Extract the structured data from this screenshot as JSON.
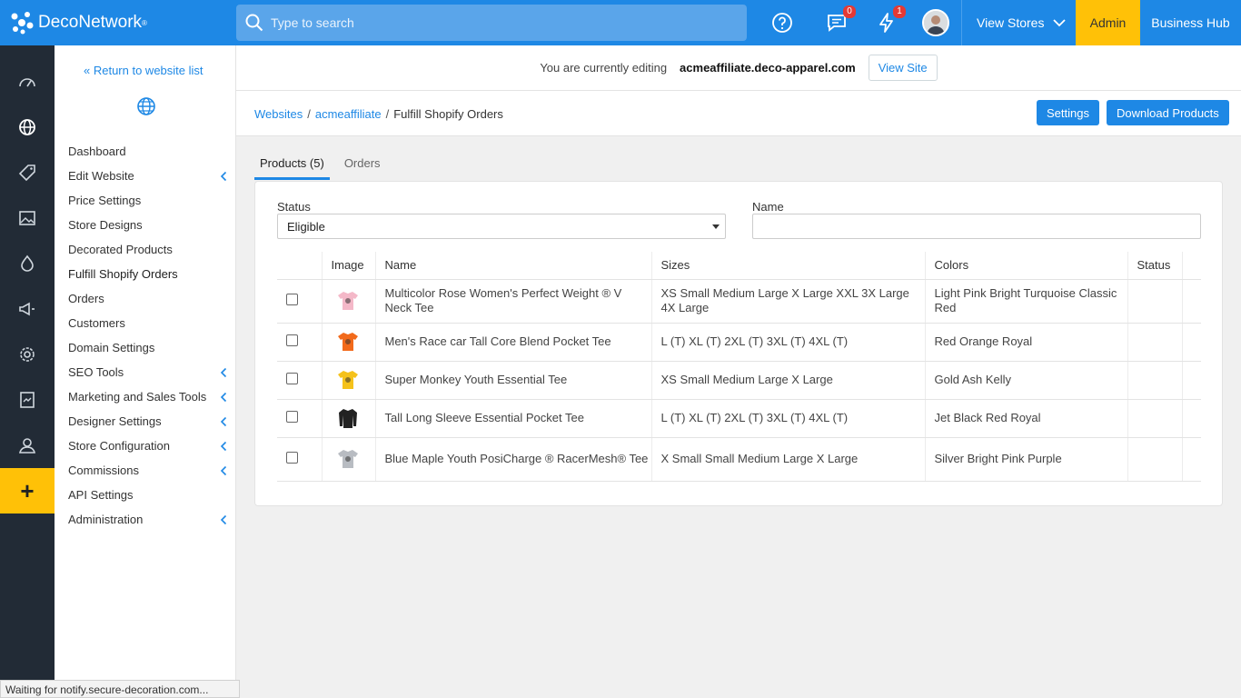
{
  "app": {
    "brand": "DecoNetwork",
    "brand_mark": "®",
    "search_placeholder": "Type to search",
    "messages_count": "0",
    "alerts_count": "1",
    "view_stores": "View Stores",
    "admin": "Admin",
    "business_hub": "Business Hub"
  },
  "sidebar": {
    "return_link": "« Return to website list",
    "items": [
      {
        "label": "Dashboard",
        "chevron": false
      },
      {
        "label": "Edit Website",
        "chevron": true
      },
      {
        "label": "Price Settings",
        "chevron": false
      },
      {
        "label": "Store Designs",
        "chevron": false
      },
      {
        "label": "Decorated Products",
        "chevron": false
      },
      {
        "label": "Fulfill Shopify Orders",
        "chevron": false,
        "active": true
      },
      {
        "label": "Orders",
        "chevron": false
      },
      {
        "label": "Customers",
        "chevron": false
      },
      {
        "label": "Domain Settings",
        "chevron": false
      },
      {
        "label": "SEO Tools",
        "chevron": true
      },
      {
        "label": "Marketing and Sales Tools",
        "chevron": true
      },
      {
        "label": "Designer Settings",
        "chevron": true
      },
      {
        "label": "Store Configuration",
        "chevron": true
      },
      {
        "label": "Commissions",
        "chevron": true
      },
      {
        "label": "API Settings",
        "chevron": false
      },
      {
        "label": "Administration",
        "chevron": true
      }
    ]
  },
  "editing": {
    "label": "You are currently editing",
    "site": "acmeaffiliate.deco-apparel.com",
    "view_site": "View Site"
  },
  "breadcrumb": {
    "root": "Websites",
    "sep": "/",
    "site": "acmeaffiliate",
    "current": "Fulfill Shopify Orders"
  },
  "actions": {
    "settings": "Settings",
    "download": "Download Products"
  },
  "tabs": {
    "products": "Products (5)",
    "orders": "Orders"
  },
  "filters": {
    "status_label": "Status",
    "status_value": "Eligible",
    "name_label": "Name",
    "name_value": ""
  },
  "table": {
    "headers": {
      "image": "Image",
      "name": "Name",
      "sizes": "Sizes",
      "colors": "Colors",
      "status": "Status"
    },
    "rows": [
      {
        "name": "Multicolor Rose Women's Perfect Weight ® V Neck Tee",
        "sizes": "XS Small Medium Large X Large XXL 3X Large 4X Large",
        "colors": "Light Pink Bright Turquoise Classic Red",
        "status": "",
        "thumb_color": "#f4b8c8"
      },
      {
        "name": "Men's Race car Tall Core Blend Pocket Tee",
        "sizes": "L (T) XL (T) 2XL (T) 3XL (T) 4XL (T)",
        "colors": "Red Orange Royal",
        "status": "",
        "thumb_color": "#f26a1b"
      },
      {
        "name": "Super Monkey Youth Essential Tee",
        "sizes": "XS Small Medium Large X Large",
        "colors": "Gold Ash Kelly",
        "status": "",
        "thumb_color": "#f5c21b"
      },
      {
        "name": "Tall Long Sleeve Essential Pocket Tee",
        "sizes": "L (T) XL (T) 2XL (T) 3XL (T) 4XL (T)",
        "colors": "Jet Black Red Royal",
        "status": "",
        "thumb_color": "#222222"
      },
      {
        "name": "Blue Maple Youth PosiCharge ® RacerMesh® Tee",
        "sizes": "X Small Small Medium Large X Large",
        "colors": "Silver Bright Pink Purple",
        "status": "",
        "thumb_color": "#b8bcc2"
      }
    ]
  },
  "statusbar": "Waiting for notify.secure-decoration.com..."
}
